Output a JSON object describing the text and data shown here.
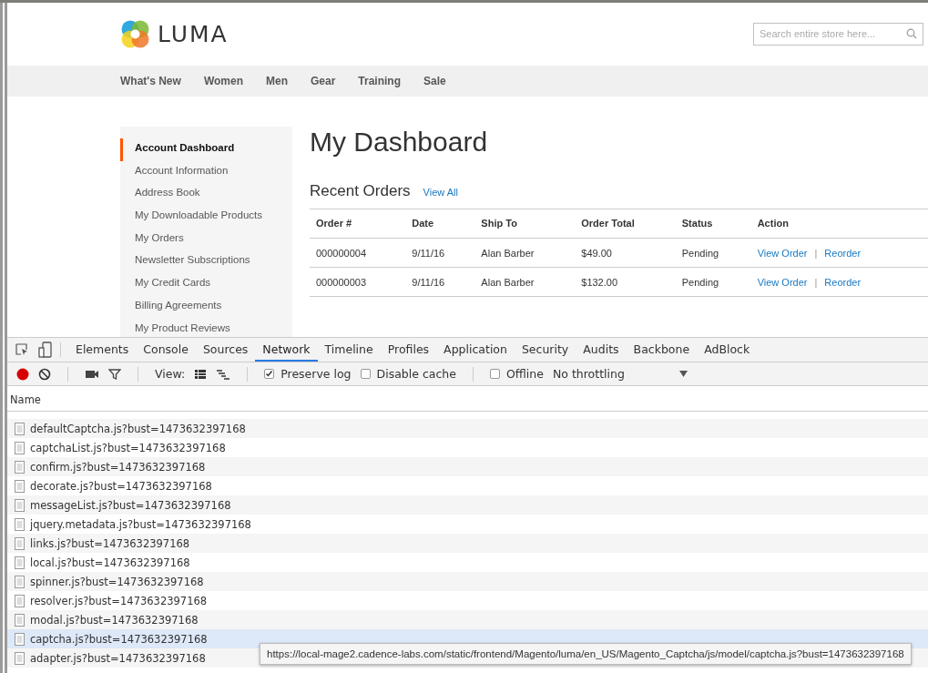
{
  "store": {
    "logo_text": "LUMA",
    "search": {
      "placeholder": "Search entire store here..."
    },
    "nav": [
      "What's New",
      "Women",
      "Men",
      "Gear",
      "Training",
      "Sale"
    ],
    "sidebar": [
      {
        "label": "Account Dashboard",
        "selected": true
      },
      {
        "label": "Account Information",
        "selected": false
      },
      {
        "label": "Address Book",
        "selected": false
      },
      {
        "label": "My Downloadable Products",
        "selected": false
      },
      {
        "label": "My Orders",
        "selected": false
      },
      {
        "label": "Newsletter Subscriptions",
        "selected": false
      },
      {
        "label": "My Credit Cards",
        "selected": false
      },
      {
        "label": "Billing Agreements",
        "selected": false
      },
      {
        "label": "My Product Reviews",
        "selected": false
      }
    ],
    "title": "My Dashboard",
    "section_title": "Recent Orders",
    "view_all": "View All",
    "orders": {
      "columns": [
        "Order #",
        "Date",
        "Ship To",
        "Order Total",
        "Status",
        "Action"
      ],
      "rows": [
        {
          "cells": [
            "000000004",
            "9/11/16",
            "Alan Barber",
            "$49.00",
            "Pending"
          ],
          "actions": [
            "View Order",
            "Reorder"
          ],
          "separator": "|"
        },
        {
          "cells": [
            "000000003",
            "9/11/16",
            "Alan Barber",
            "$132.00",
            "Pending"
          ],
          "actions": [
            "View Order",
            "Reorder"
          ],
          "separator": "|"
        }
      ]
    }
  },
  "devtools": {
    "tabs": [
      {
        "label": "Elements",
        "selected": false
      },
      {
        "label": "Console",
        "selected": false
      },
      {
        "label": "Sources",
        "selected": false
      },
      {
        "label": "Network",
        "selected": true
      },
      {
        "label": "Timeline",
        "selected": false
      },
      {
        "label": "Profiles",
        "selected": false
      },
      {
        "label": "Application",
        "selected": false
      },
      {
        "label": "Security",
        "selected": false
      },
      {
        "label": "Audits",
        "selected": false
      },
      {
        "label": "Backbone",
        "selected": false
      },
      {
        "label": "AdBlock",
        "selected": false
      }
    ],
    "recording": true,
    "view_label": "View:",
    "checkboxes": [
      {
        "label": "Preserve log",
        "checked": true
      },
      {
        "label": "Disable cache",
        "checked": false
      },
      {
        "label": "Offline",
        "checked": false
      }
    ],
    "throttling": "No throttling",
    "column": "Name",
    "requests": [
      {
        "name": "defaultCaptcha.js?bust=1473632397168",
        "selected": false
      },
      {
        "name": "captchaList.js?bust=1473632397168",
        "selected": false
      },
      {
        "name": "confirm.js?bust=1473632397168",
        "selected": false
      },
      {
        "name": "decorate.js?bust=1473632397168",
        "selected": false
      },
      {
        "name": "messageList.js?bust=1473632397168",
        "selected": false
      },
      {
        "name": "jquery.metadata.js?bust=1473632397168",
        "selected": false
      },
      {
        "name": "links.js?bust=1473632397168",
        "selected": false
      },
      {
        "name": "local.js?bust=1473632397168",
        "selected": false
      },
      {
        "name": "spinner.js?bust=1473632397168",
        "selected": false
      },
      {
        "name": "resolver.js?bust=1473632397168",
        "selected": false
      },
      {
        "name": "modal.js?bust=1473632397168",
        "selected": false
      },
      {
        "name": "captcha.js?bust=1473632397168",
        "selected": true
      },
      {
        "name": "adapter.js?bust=1473632397168",
        "selected": false
      }
    ],
    "tooltip": "https://local-mage2.cadence-labs.com/static/frontend/Magento/luma/en_US/Magento_Captcha/js/model/captcha.js?bust=1473632397168"
  }
}
